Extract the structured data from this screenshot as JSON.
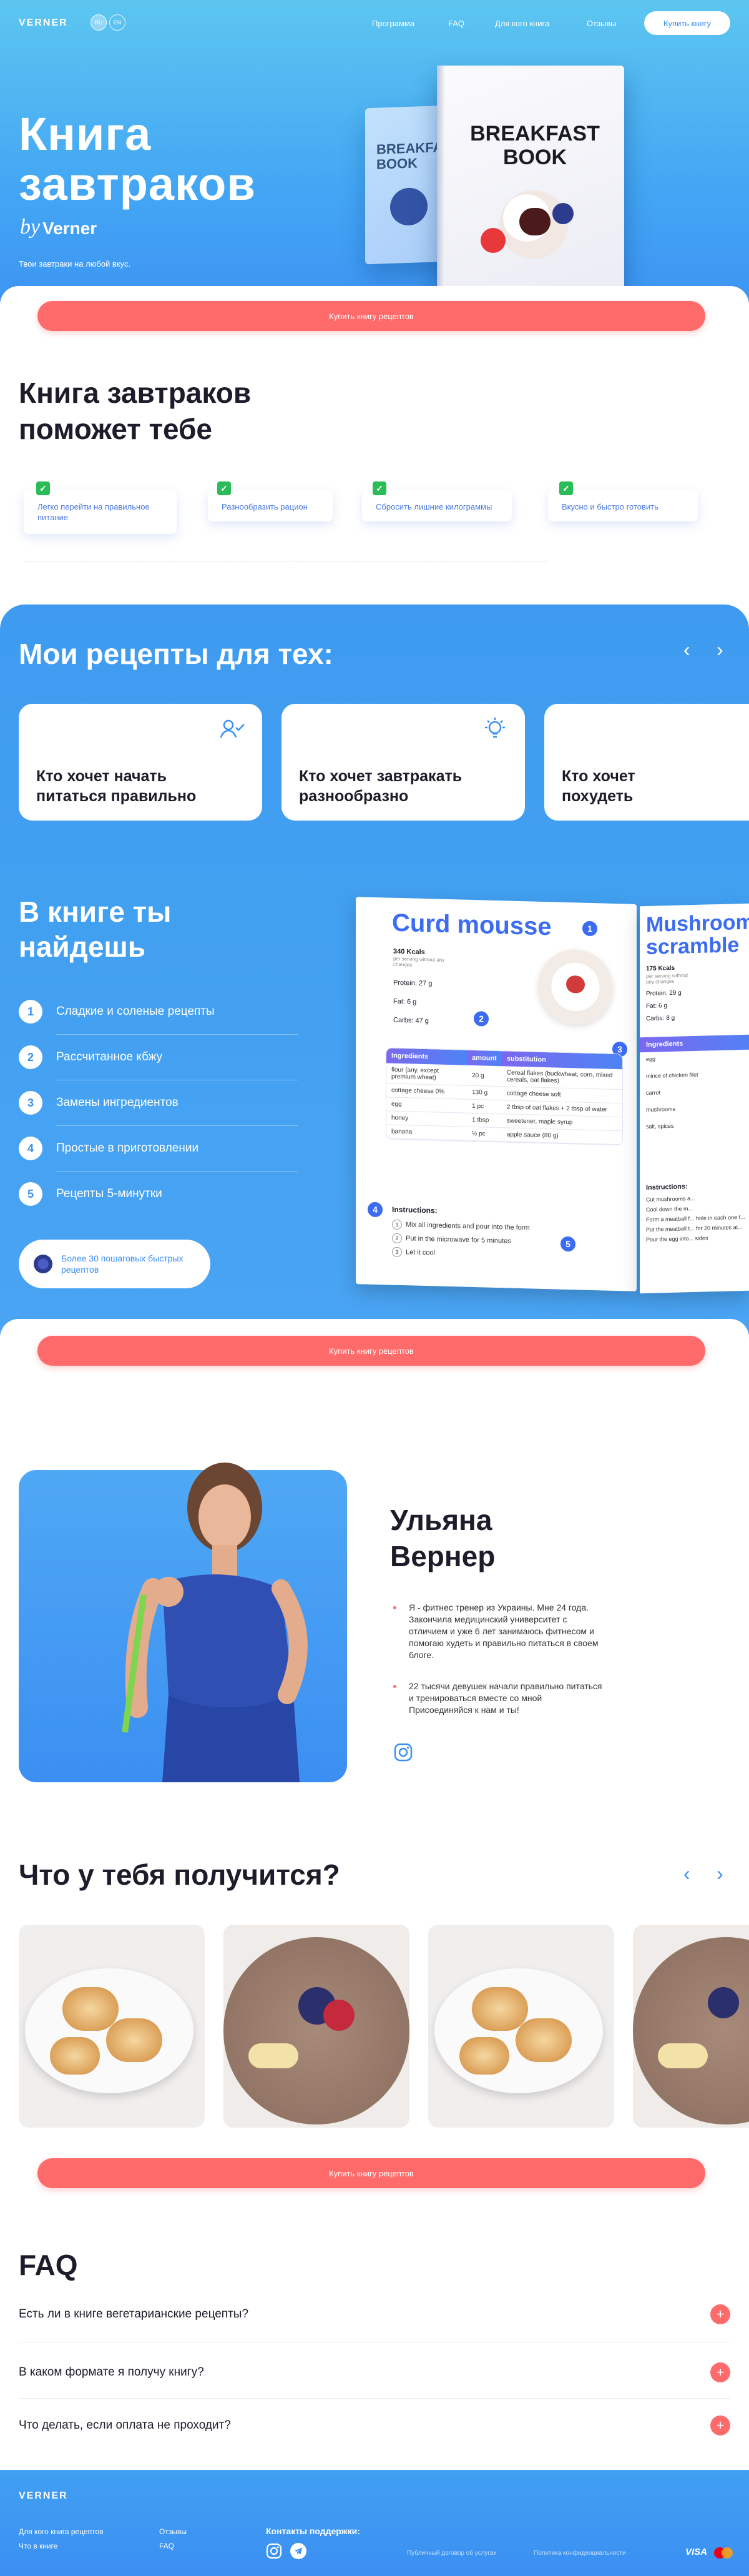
{
  "header": {
    "logo": "VERNER",
    "langs": [
      "RU",
      "EN"
    ],
    "nav": [
      "Программа",
      "FAQ",
      "Для кого книга",
      "Отзывы"
    ],
    "buy_button": "Купить книгу"
  },
  "hero": {
    "title_line1": "Книга",
    "title_line2": "завтраков",
    "by": "by",
    "author": "Verner",
    "subtitle": "Твои завтраки на любой вкус.",
    "cta": "Купить книгу рецептов",
    "book_front_title": "BREAKFAST BOOK",
    "book_back_title": "BREAKFAST BOOK"
  },
  "benefits": {
    "title_line1": "Книга завтраков",
    "title_line2": "поможет тебе",
    "items": [
      "Легко перейти на правильное питание",
      "Разнообразить рацион",
      "Сбросить лишние килограммы",
      "Вкусно и быстро готовить"
    ]
  },
  "recipes_for": {
    "title": "Мои рецепты для тех:",
    "cards": [
      {
        "title": "Кто хочет начать питаться правильно",
        "icon": "user-check-icon"
      },
      {
        "title": "Кто хочет завтракать разнообразно",
        "icon": "lightbulb-icon"
      },
      {
        "title": "Кто хочет похудеть",
        "icon": ""
      }
    ]
  },
  "inside": {
    "title_line1": "В книге ты",
    "title_line2": "найдешь",
    "items": [
      "Сладкие и соленые рецепты",
      "Рассчитанное кбжу",
      "Замены ингредиентов",
      "Простые в приготовлении",
      "Рецепты 5-минутки"
    ],
    "badge": "Более 30 пошаговых быстрых рецептов"
  },
  "spread": {
    "recipe": "Curd mousse",
    "kcal": "340 Kcals",
    "kcal_note": "per serving without any changes",
    "protein": "Protein: 27 g",
    "fat": "Fat: 6 g",
    "carbs": "Carbs: 47 g",
    "headers": [
      "Ingredients",
      "amount",
      "substitution"
    ],
    "rows": [
      [
        "flour (any, except premium wheat)",
        "20 g",
        "Cereal flakes (buckwheat, corn, mixed cereals, oat flakes)"
      ],
      [
        "cottage cheese 0%",
        "130 g",
        "cottage cheese soft"
      ],
      [
        "egg",
        "1 pc",
        "2 tbsp of oat flakes + 2 tbsp of water"
      ],
      [
        "honey",
        "1 tbsp",
        "sweetener, maple syrup"
      ],
      [
        "banana",
        "½ pc",
        "apple sauce (80 g)"
      ]
    ],
    "instructions_label": "Instructions:",
    "steps": [
      "Mix all ingredients and pour into the form",
      "Put in the microwave for 5 minutes",
      "Let it cool"
    ],
    "callouts": [
      "1",
      "2",
      "3",
      "4",
      "5"
    ],
    "right_title": "Mushroom scramble",
    "right_kcal": "175 Kcals",
    "right_kcal_note": "per serving without any changes",
    "right_protein": "Protein: 29 g",
    "right_fat": "Fat: 6 g",
    "right_carbs": "Carbs: 8 g",
    "right_ingredients_label": "Ingredients",
    "right_rows": [
      "egg",
      "mince of chicken filet",
      "carrot",
      "mushrooms",
      "salt, spices"
    ],
    "right_instructions_label": "Instructions:",
    "right_steps": [
      "Cut mushrooms a...",
      "Cool down the m...",
      "Form a meatball f... hole in each one f...",
      "Put the meatball t... for 20 minutes at...",
      "Pour the egg into... sides"
    ]
  },
  "cta2": "Купить книгу рецептов",
  "author": {
    "name_line1": "Ульяна",
    "name_line2": "Вернер",
    "p1": "Я - фитнес тренер из Украины. Мне 24 года. Закончила медицинский университет с отличием и уже 6 лет занимаюсь фитнесом и помогаю худеть и правильно питаться в своем блоге.",
    "p2": "22 тысячи девушек начали правильно питаться и тренироваться вместе со мной Присоединяйся к нам и ты!"
  },
  "results": {
    "title": "Что у тебя получится?",
    "cta": "Купить книгу рецептов"
  },
  "faq": {
    "title": "FAQ",
    "items": [
      "Есть ли в книге вегетарианские рецепты?",
      "В каком формате я получу книгу?",
      "Что делать, если оплата не проходит?"
    ]
  },
  "footer": {
    "logo": "VERNER",
    "col1": [
      "Для кого книга рецептов",
      "Что в книге"
    ],
    "col2": [
      "Отзывы",
      "FAQ"
    ],
    "support": "Контакты поддержки:",
    "legal1": "Публичный договор об услугах",
    "legal2": "Политика конфиденциальности",
    "payments": [
      "VISA",
      "Mastercard"
    ]
  },
  "colors": {
    "accent": "#3b8ff2",
    "cta": "#ff6b6b",
    "check": "#2bbb57"
  }
}
